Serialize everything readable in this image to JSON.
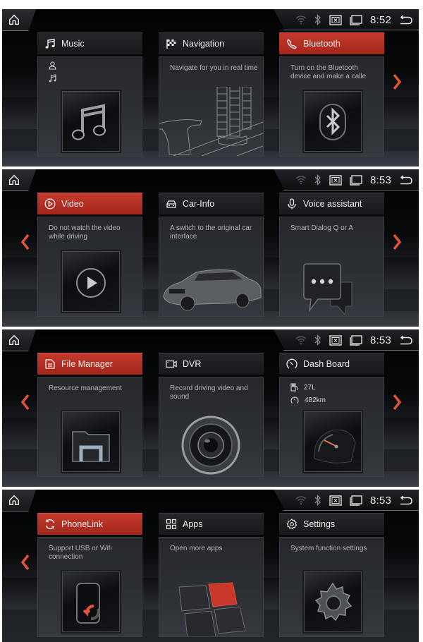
{
  "colors": {
    "accent_red": "#b8302a",
    "chevron_red": "#e0533a",
    "text_primary": "#f0f0f0",
    "text_secondary": "#b4b6ba"
  },
  "screens": [
    {
      "status_bar": {
        "icons": [
          "wifi-icon",
          "bluetooth-icon",
          "screen-off-icon",
          "multitask-icon",
          "back-icon"
        ],
        "time": "8:52"
      },
      "nav": {
        "left_arrow": false,
        "right_arrow": true
      },
      "cards": [
        {
          "title": "Music",
          "icon": "music-note-icon",
          "active": false,
          "info": [
            {
              "icon": "artist-icon",
              "text": ""
            },
            {
              "icon": "song-icon",
              "text": ""
            }
          ],
          "art": "music-art"
        },
        {
          "title": "Navigation",
          "icon": "checkered-flag-icon",
          "active": false,
          "description": "Navigate for you in real time",
          "art": "navigation-art"
        },
        {
          "title": "Bluetooth",
          "icon": "phone-handset-icon",
          "active": true,
          "description": "Turn on the Bluetooth device and make a calle",
          "art": "bluetooth-art"
        }
      ]
    },
    {
      "status_bar": {
        "icons": [
          "wifi-icon",
          "bluetooth-icon",
          "screen-off-icon",
          "multitask-icon",
          "back-icon"
        ],
        "time": "8:53"
      },
      "nav": {
        "left_arrow": true,
        "right_arrow": true
      },
      "cards": [
        {
          "title": "Video",
          "icon": "play-circle-icon",
          "active": true,
          "description": "Do not watch the video while driving",
          "art": "video-art"
        },
        {
          "title": "Car-Info",
          "icon": "car-icon",
          "active": false,
          "description": "A switch to the original car interface",
          "art": "car-art"
        },
        {
          "title": "Voice assistant",
          "icon": "microphone-icon",
          "active": false,
          "description": "Smart Dialog Q or A",
          "art": "chat-bubble-art"
        }
      ]
    },
    {
      "status_bar": {
        "icons": [
          "wifi-icon",
          "bluetooth-icon",
          "screen-off-icon",
          "multitask-icon",
          "back-icon"
        ],
        "time": "8:53"
      },
      "nav": {
        "left_arrow": true,
        "right_arrow": true
      },
      "cards": [
        {
          "title": "File Manager",
          "icon": "document-icon",
          "active": true,
          "description": "Resource management",
          "art": "folder-art"
        },
        {
          "title": "DVR",
          "icon": "camera-icon",
          "active": false,
          "description": "Record driving video and sound",
          "art": "camera-lens-art"
        },
        {
          "title": "Dash Board",
          "icon": "gauge-icon",
          "active": false,
          "info": [
            {
              "icon": "fuel-icon",
              "text": "27L"
            },
            {
              "icon": "odometer-icon",
              "text": "482km"
            }
          ],
          "art": "gauge-art"
        }
      ]
    },
    {
      "status_bar": {
        "icons": [
          "wifi-icon",
          "bluetooth-icon",
          "screen-off-icon",
          "multitask-icon",
          "back-icon"
        ],
        "time": "8:53"
      },
      "nav": {
        "left_arrow": true,
        "right_arrow": false
      },
      "cards": [
        {
          "title": "PhoneLink",
          "icon": "sync-icon",
          "active": true,
          "description": "Support USB or Wifi connection",
          "art": "phone-sync-art"
        },
        {
          "title": "Apps",
          "icon": "grid-icon",
          "active": false,
          "description": "Open more apps",
          "art": "apps-tiles-art"
        },
        {
          "title": "Settings",
          "icon": "gear-icon",
          "active": false,
          "description": "System function settings",
          "art": "gear-art"
        }
      ]
    }
  ]
}
